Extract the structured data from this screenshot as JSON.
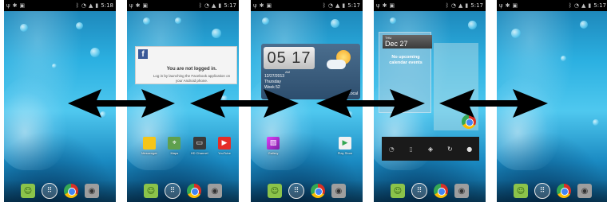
{
  "screens": [
    {
      "id": "home-blank-1",
      "time": "5:18"
    },
    {
      "id": "home-facebook",
      "time": "5:17"
    },
    {
      "id": "home-clock",
      "time": "5:17"
    },
    {
      "id": "home-calendar",
      "time": "5:17"
    },
    {
      "id": "home-blank-2",
      "time": "5:17"
    }
  ],
  "dock": {
    "icons": [
      "messaging-icon",
      "apps-icon",
      "chrome-icon",
      "camera-icon"
    ]
  },
  "facebook_widget": {
    "title": "You are not logged in.",
    "body": "Log in by launching the Facebook application on your Android phone."
  },
  "screen2_apps": [
    {
      "label": "Messenger",
      "color": "#f5c518",
      "icon": "folder-icon"
    },
    {
      "label": "Maps",
      "color": "#5fa04e",
      "icon": "maps-icon"
    },
    {
      "label": "HD Channel",
      "color": "#3a3a3a",
      "icon": "tv-icon"
    },
    {
      "label": "YouTube",
      "color": "#e52d27",
      "icon": "youtube-icon"
    }
  ],
  "clock_widget": {
    "time": "05 17",
    "ampm": "AM",
    "date": "12/27/2013",
    "weekday": "Thursday",
    "week": "Week 52",
    "location": "Local"
  },
  "screen3_apps": [
    {
      "label": "Gallery",
      "color": "#8e44ad"
    },
    {
      "label": "Play Store",
      "color": "#f2f2f2"
    }
  ],
  "calendar_widget": {
    "day": "THU",
    "date": "Dec 27",
    "empty_message": "No upcoming calendar events"
  },
  "arrows": {
    "color": "#000000"
  }
}
